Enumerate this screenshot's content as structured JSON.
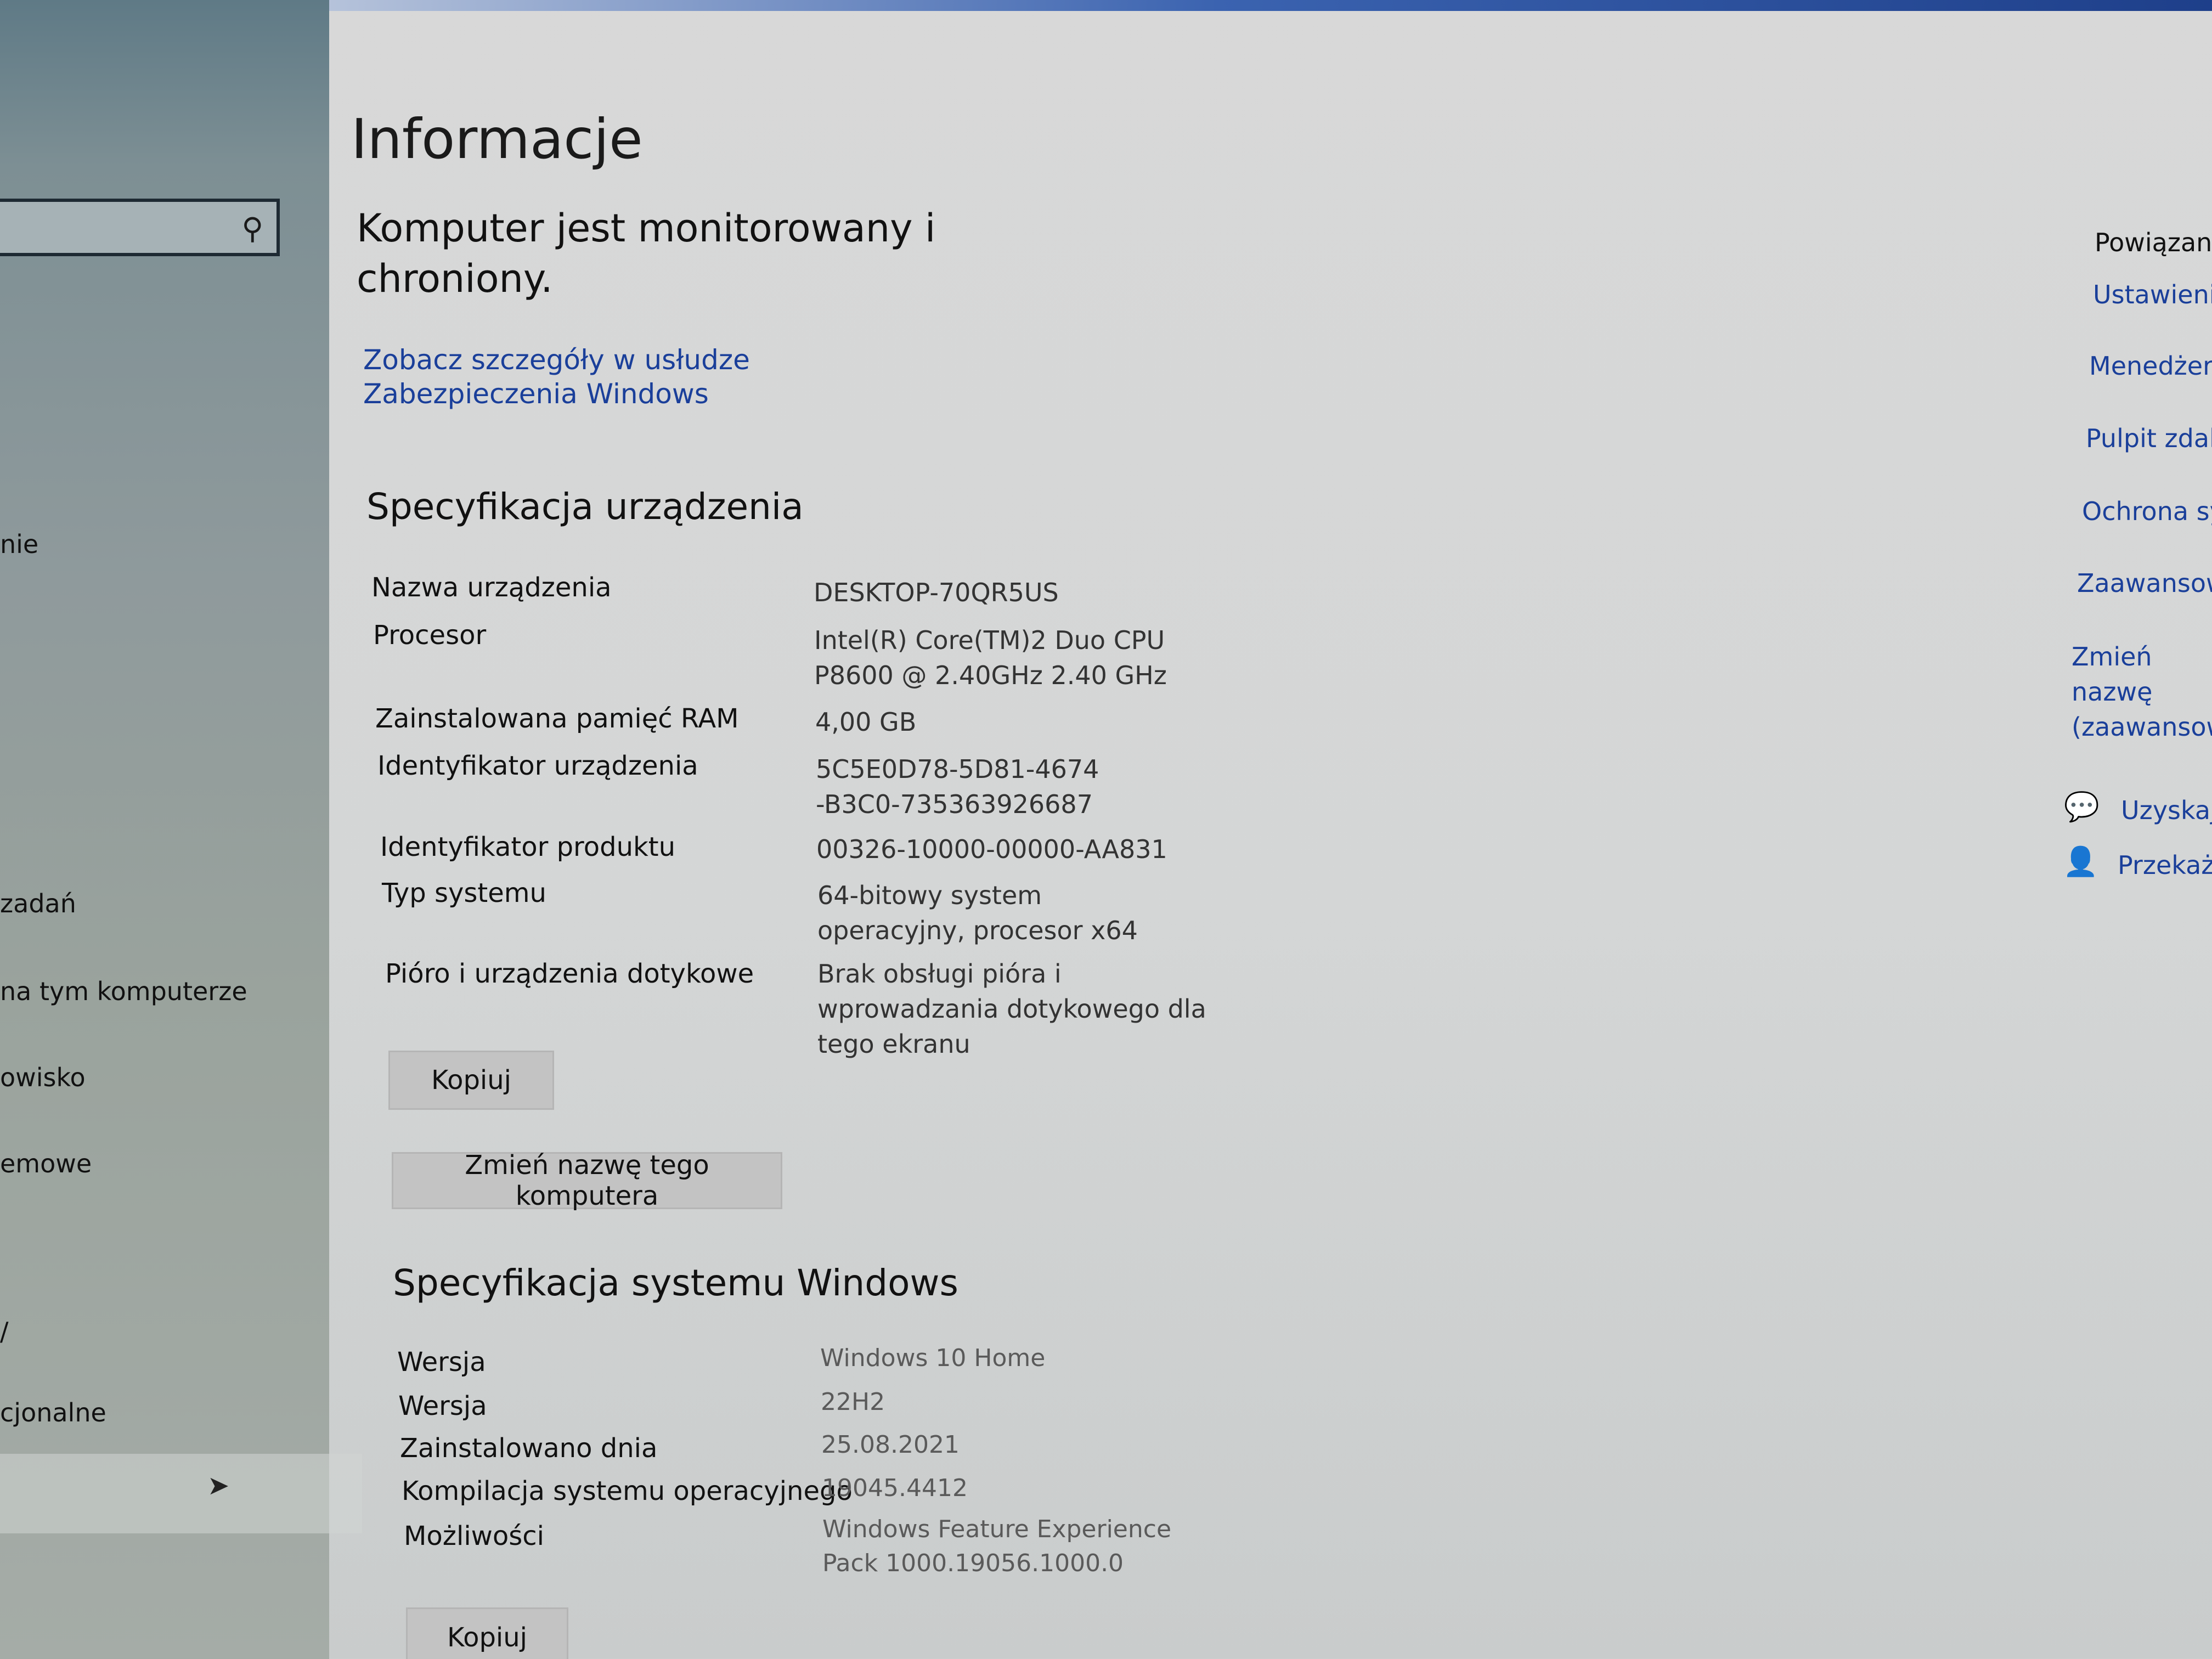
{
  "sidebar": {
    "items": [
      {
        "label": "nie"
      },
      {
        "label": "zadań"
      },
      {
        "label": "na tym komputerze"
      },
      {
        "label": "owisko"
      },
      {
        "label": "emowe"
      },
      {
        "label": "/"
      },
      {
        "label": "cjonalne"
      }
    ]
  },
  "page": {
    "title": "Informacje",
    "monitor_text": "Komputer jest monitorowany i chroniony.",
    "security_link": "Zobacz szczegóły w usłudze Zabezpieczenia Windows"
  },
  "device_spec": {
    "title": "Specyfikacja urządzenia",
    "rows": [
      {
        "label": "Nazwa urządzenia",
        "value": "DESKTOP-70QR5US"
      },
      {
        "label": "Procesor",
        "value": "Intel(R) Core(TM)2 Duo CPU P8600  @ 2.40GHz   2.40 GHz"
      },
      {
        "label": "Zainstalowana pamięć RAM",
        "value": "4,00 GB"
      },
      {
        "label": "Identyfikator urządzenia",
        "value": "5C5E0D78-5D81-4674-B3C0-735363926687"
      },
      {
        "label": "Identyfikator produktu",
        "value": "00326-10000-00000-AA831"
      },
      {
        "label": "Typ systemu",
        "value": "64-bitowy system operacyjny, procesor x64"
      },
      {
        "label": "Pióro i urządzenia dotykowe",
        "value": "Brak obsługi pióra i wprowadzania dotykowego dla tego ekranu"
      }
    ],
    "copy_button": "Kopiuj",
    "rename_button": "Zmień nazwę tego komputera"
  },
  "windows_spec": {
    "title": "Specyfikacja systemu Windows",
    "rows": [
      {
        "label": "Wersja",
        "value": "Windows 10 Home"
      },
      {
        "label": "Wersja",
        "value": "22H2"
      },
      {
        "label": "Zainstalowano dnia",
        "value": "25.08.2021"
      },
      {
        "label": "Kompilacja systemu operacyjnego",
        "value": "19045.4412"
      },
      {
        "label": "Możliwości",
        "value": "Windows Feature Experience Pack 1000.19056.1000.0"
      }
    ],
    "copy_button": "Kopiuj"
  },
  "related": {
    "title": "Powiązane",
    "links": [
      {
        "label": "Ustawienia"
      },
      {
        "label": "Menedżer u"
      },
      {
        "label": "Pulpit zdaln"
      },
      {
        "label": "Ochrona sys"
      },
      {
        "label": "Zaawansowa"
      },
      {
        "label": "Zmień nazwę (zaawansowa"
      }
    ],
    "help": [
      {
        "label": "Uzyskaj p",
        "icon": "help-chat-icon"
      },
      {
        "label": "Przekaż o",
        "icon": "feedback-icon"
      }
    ]
  },
  "colors": {
    "link": "#1a3f9a",
    "button": "#c3c3c3",
    "background": "#d8d8d8"
  }
}
